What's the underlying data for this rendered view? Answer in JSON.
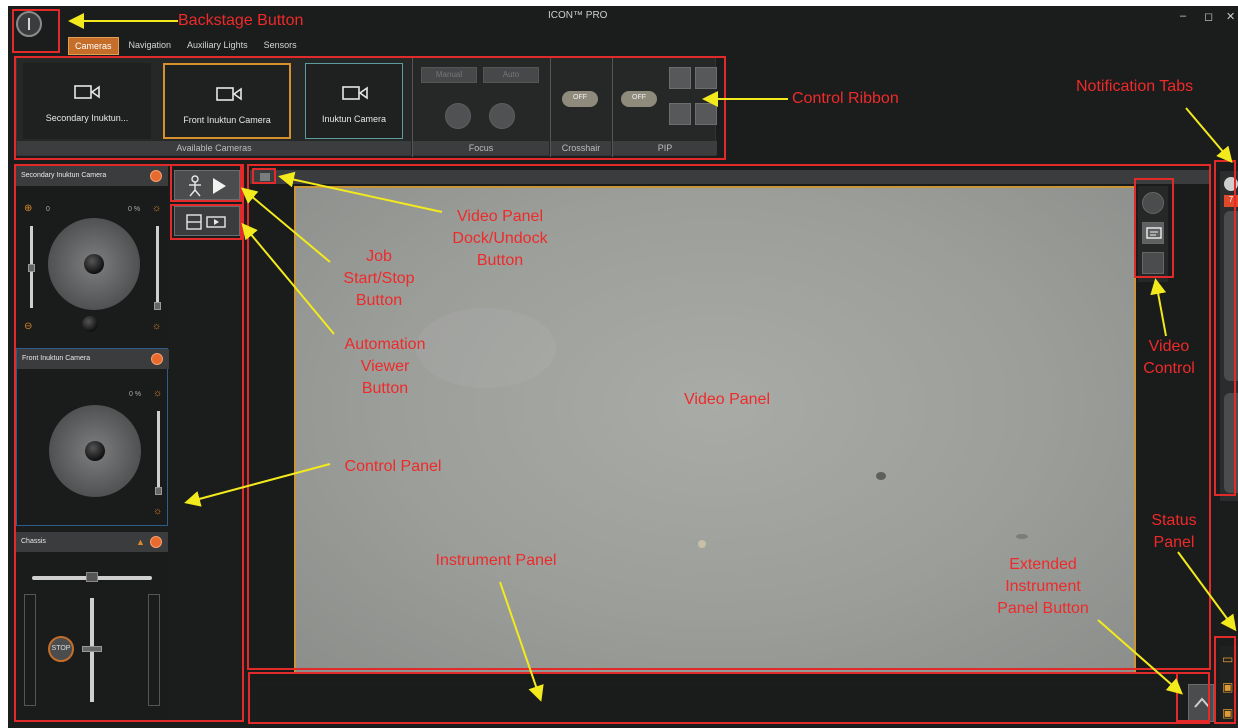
{
  "app": {
    "title": "ICON™ PRO",
    "min_glyph": "–",
    "max_glyph": "◻",
    "close_glyph": "✕"
  },
  "tabs": [
    "Cameras",
    "Navigation",
    "Auxiliary Lights",
    "Sensors"
  ],
  "ribbon": {
    "cameras": [
      "Secondary Inuktun...",
      "Front Inuktun Camera",
      "Inuktun Camera"
    ],
    "groups": {
      "available_cameras": "Available Cameras",
      "focus": "Focus",
      "crosshair": "Crosshair",
      "pip": "PIP"
    },
    "focus_buttons": [
      "Manual",
      "Auto"
    ],
    "crosshair_toggle": "OFF",
    "pip_toggle": "OFF"
  },
  "panels": {
    "secondary": {
      "title": "Secondary Inuktun Camera",
      "percent": "0 %",
      "zero": "0"
    },
    "front": {
      "title": "Front Inuktun Camera",
      "percent": "0 %"
    },
    "chassis": {
      "title": "Chassis",
      "stop": "STOP"
    }
  },
  "annotations": {
    "backstage": "Backstage Button",
    "ribbon": "Control Ribbon",
    "notifications": "Notification Tabs",
    "dock": "Video Panel\nDock/Undock\nButton",
    "job": "Job\nStart/Stop\nButton",
    "automation": "Automation\nViewer\nButton",
    "video_control": "Video\nControl",
    "video_panel": "Video Panel",
    "control_panel": "Control Panel",
    "status": "Status\nPanel",
    "instrument": "Instrument Panel",
    "extended": "Extended\nInstrument\nPanel Button"
  },
  "colors": {
    "annotation": "#e22a2a",
    "arrow": "#f2ea1c",
    "accent": "#c46e2a",
    "video_border": "#c99536"
  },
  "notification_count": "7"
}
